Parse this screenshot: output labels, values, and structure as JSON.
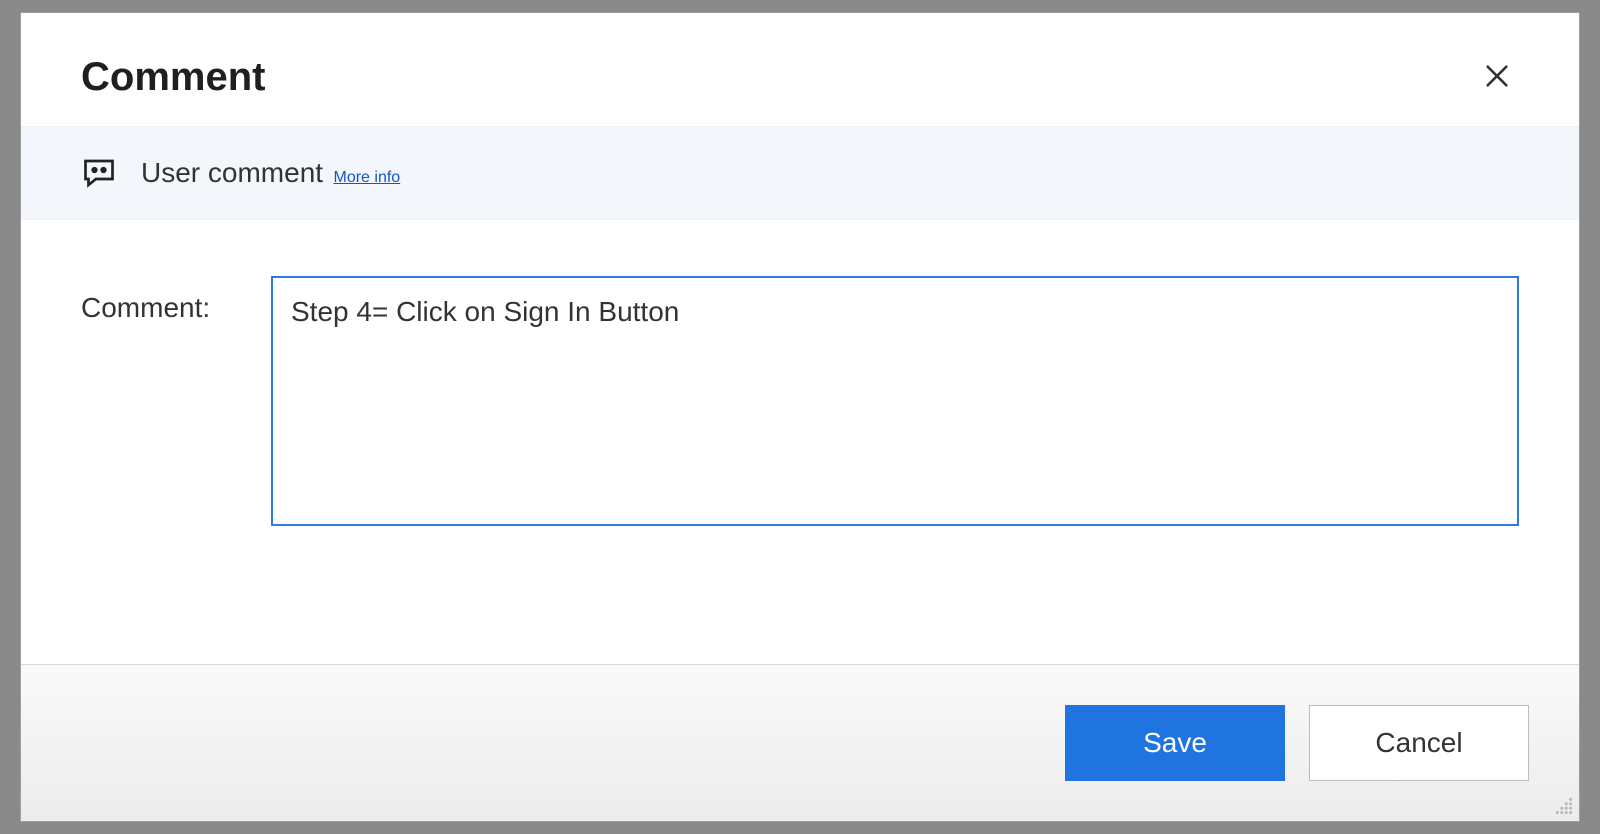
{
  "dialog": {
    "title": "Comment",
    "info_label": "User comment",
    "more_info_link": "More info",
    "field_label": "Comment:",
    "comment_value": "Step 4= Click on Sign In Button",
    "save_label": "Save",
    "cancel_label": "Cancel"
  }
}
